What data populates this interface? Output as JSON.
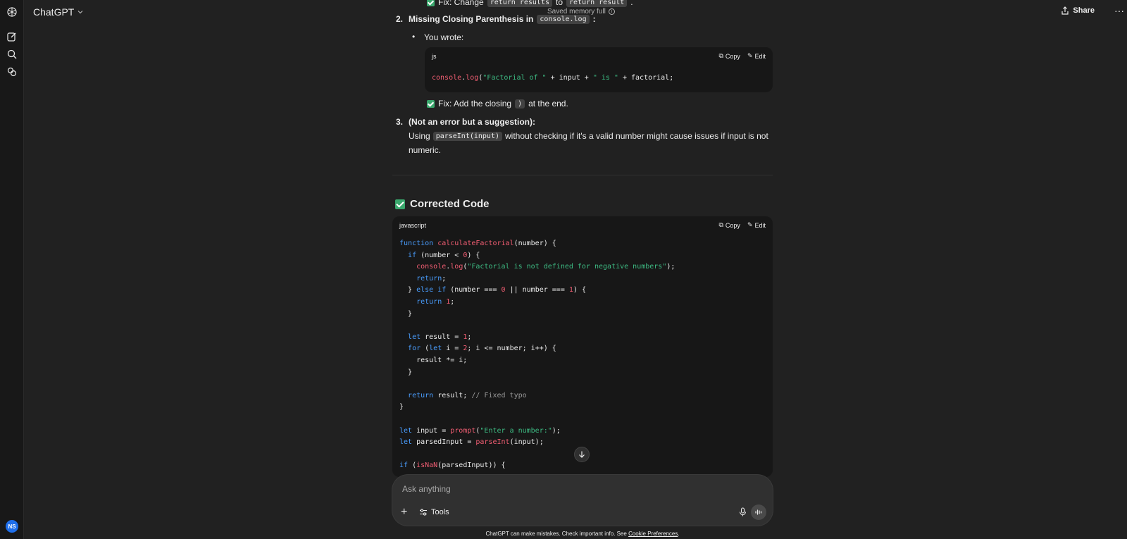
{
  "app": {
    "title": "ChatGPT",
    "memory_status": "Saved memory full",
    "share_label": "Share",
    "more_label": "···",
    "avatar_initials": "NS"
  },
  "message": {
    "fix1_prefix": "Fix: Change",
    "fix1_from": "return results",
    "fix1_mid": "to",
    "fix1_to": "return result",
    "fix1_end": ".",
    "item2_number": "2.",
    "item2_title": "Missing Closing Parenthesis in",
    "item2_code": "console.log",
    "item2_colon": ":",
    "item2_bullet": "You wrote:",
    "snippet": {
      "lang": "js",
      "copy_label": "Copy",
      "edit_label": "Edit"
    },
    "fix2_prefix": "Fix: Add the closing",
    "fix2_code": ")",
    "fix2_suffix": "at the end.",
    "item3_number": "3.",
    "item3_title": "(Not an error but a suggestion):",
    "item3_pre": "Using",
    "item3_code": "parseInt(input)",
    "item3_post": "without checking if it's a valid number might cause issues if input is not",
    "item3_line2": "numeric.",
    "section_title": "Corrected Code",
    "code": {
      "lang": "javascript",
      "copy_label": "Copy",
      "edit_label": "Edit"
    }
  },
  "composer": {
    "placeholder": "Ask anything",
    "tools_label": "Tools"
  },
  "footer": {
    "text": "ChatGPT can make mistakes. Check important info. See",
    "link": "Cookie Preferences",
    "end": "."
  },
  "colors": {
    "background": "#212121",
    "code_background": "#171717",
    "keyword": "#4a9eff",
    "function": "#f05d72",
    "string": "#3dbb83",
    "check_green": "#3aa76d",
    "avatar": "#1f6feb"
  }
}
